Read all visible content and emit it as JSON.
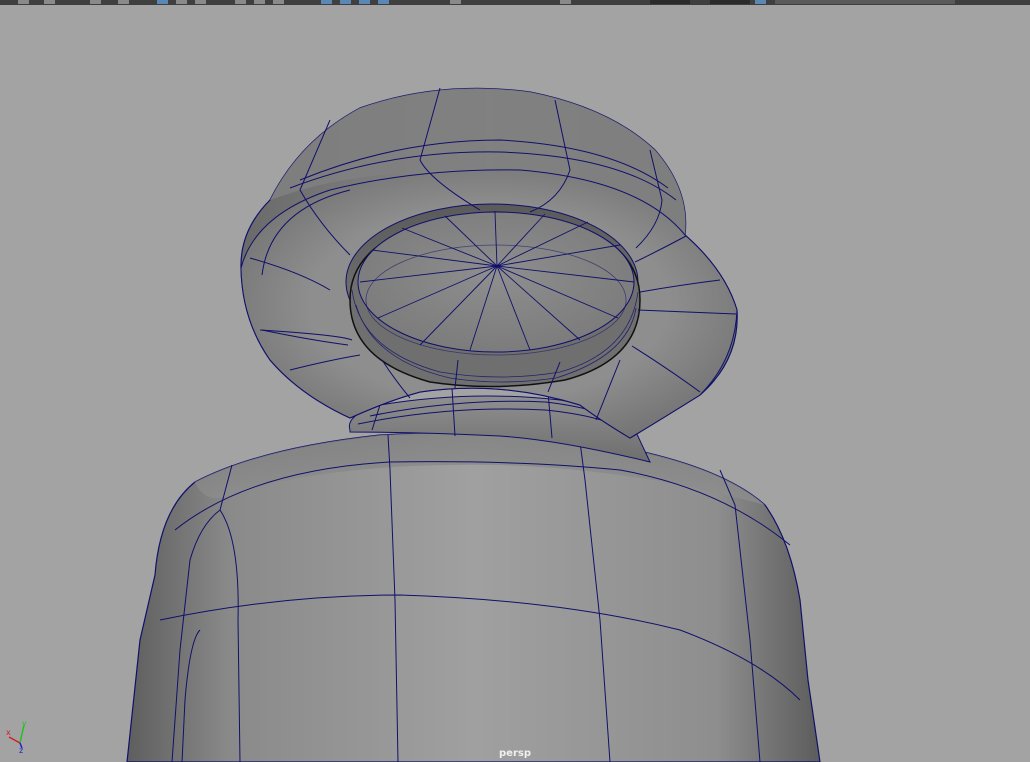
{
  "viewport": {
    "camera": "persp",
    "background": "#a3a3a3",
    "wireframe_color": "#10106a"
  },
  "axis": {
    "x": "x",
    "y": "y",
    "z": "z"
  },
  "toolbar": {
    "items": [
      "undo-icon",
      "redo-icon",
      "select-tool-icon",
      "lasso-tool-icon",
      "move-tool-icon",
      "rotate-tool-icon",
      "scale-tool-icon",
      "snap-grid-icon",
      "snap-curve-icon",
      "snap-point-icon",
      "snap-surface-icon",
      "render-icon",
      "ipr-render-icon",
      "render-settings-icon",
      "playblast-icon",
      "viewport-shading-icon"
    ]
  }
}
